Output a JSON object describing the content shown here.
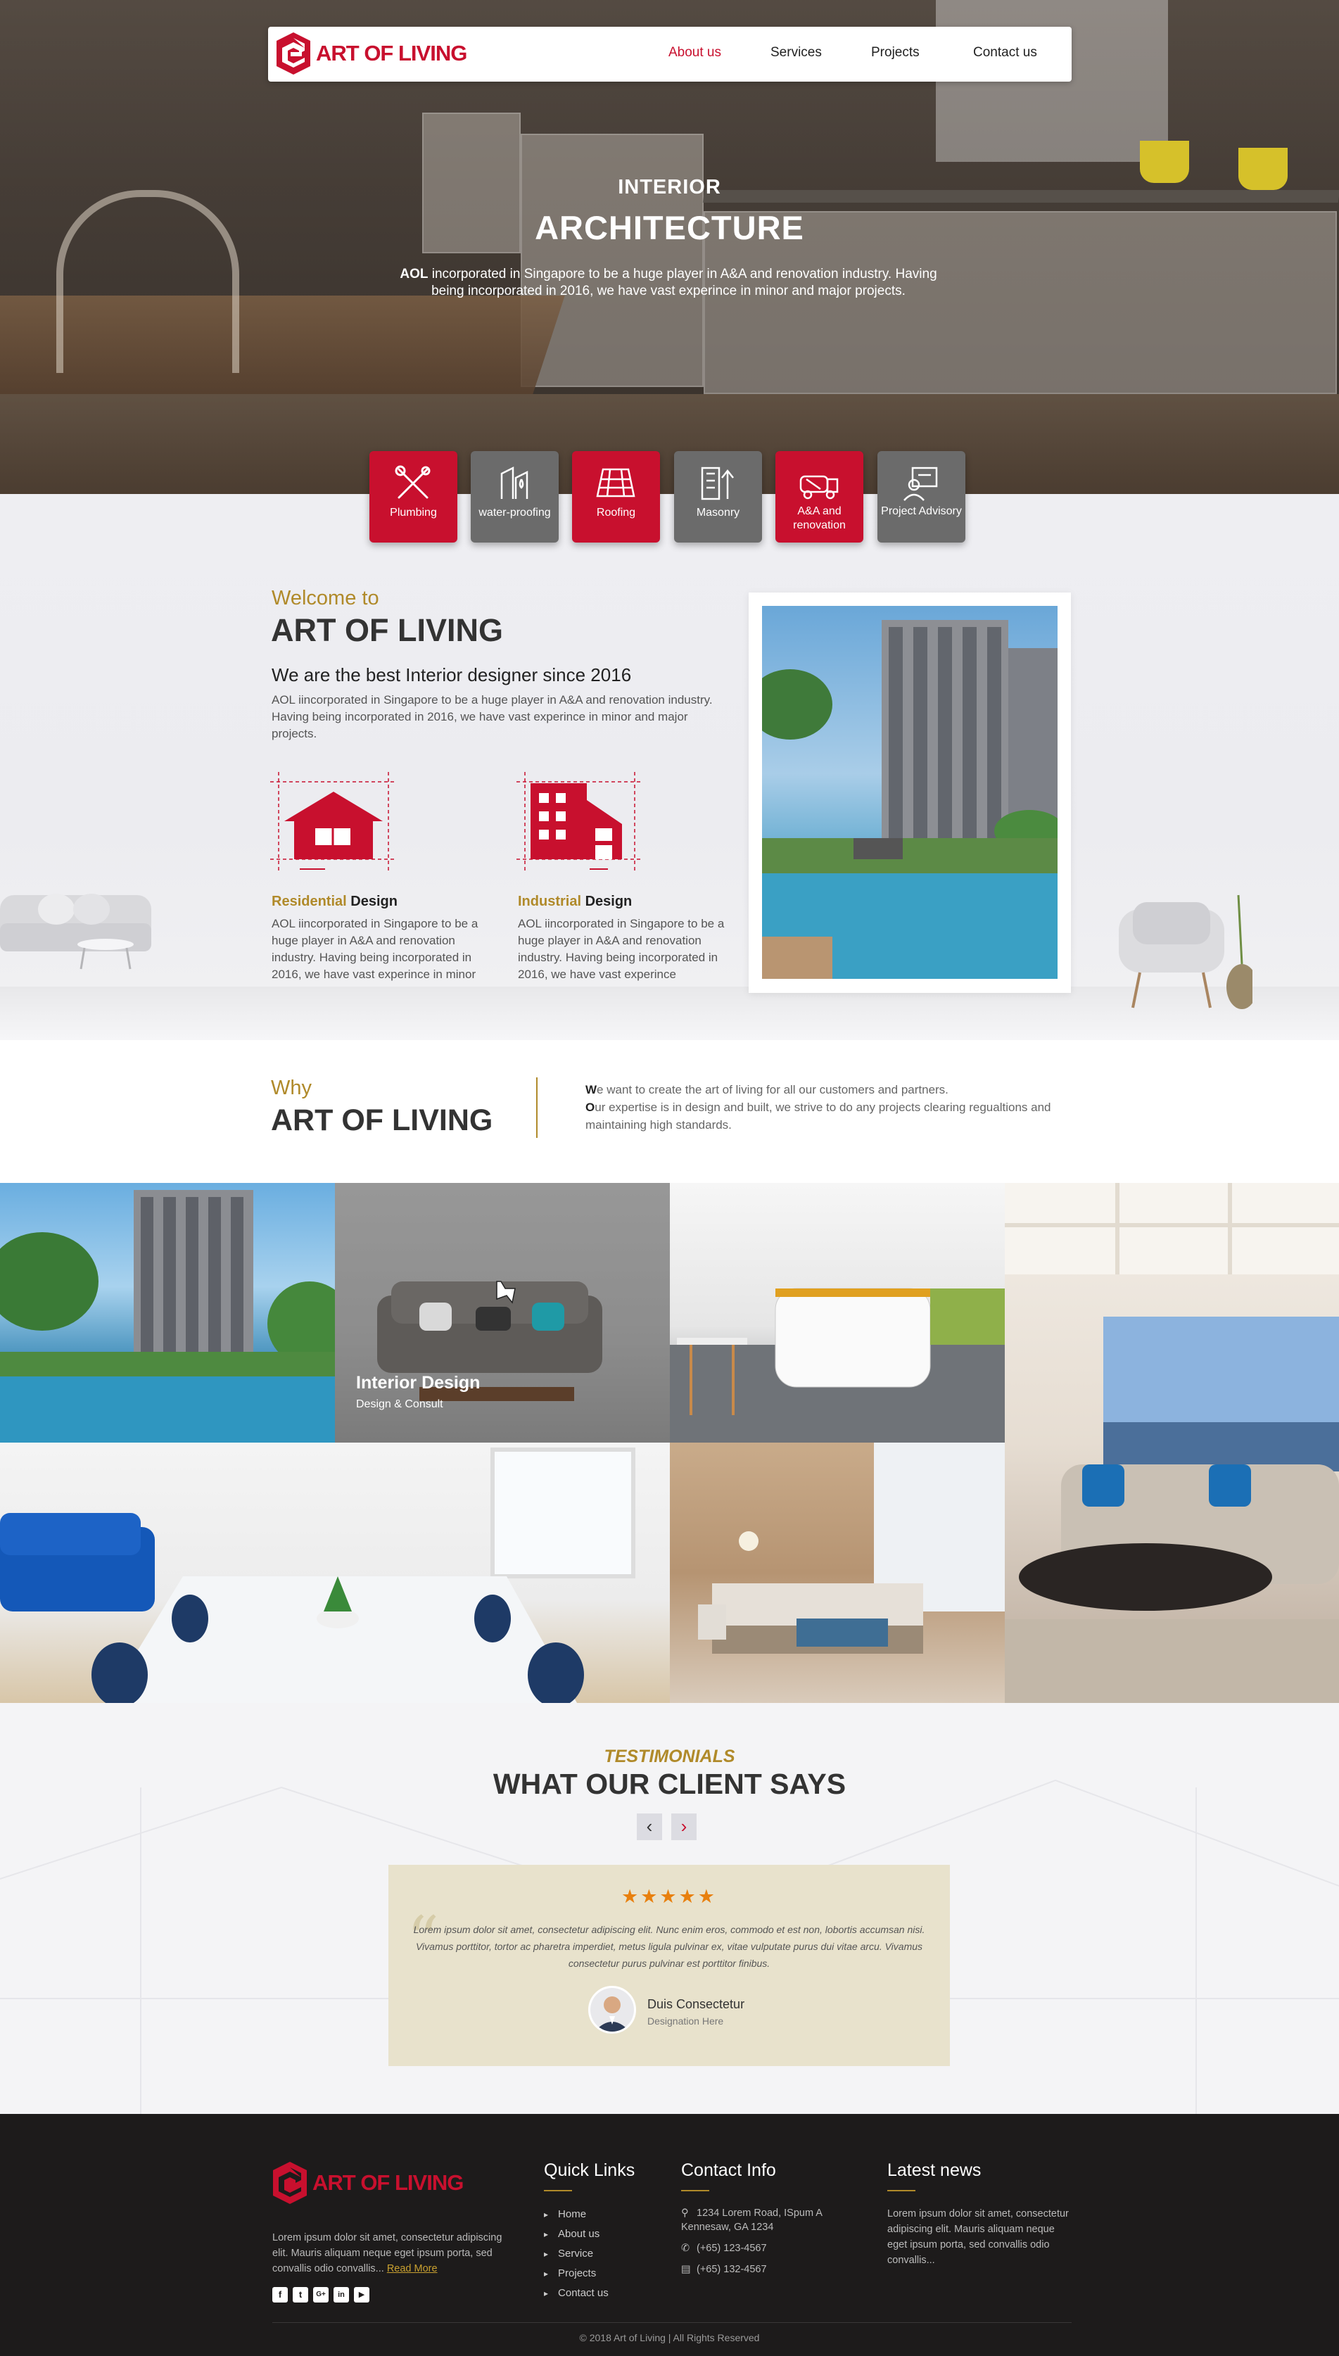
{
  "brand": {
    "name": "ART OF LIVING",
    "color": "#c8102e",
    "accent": "#b08a2a"
  },
  "nav": {
    "items": [
      {
        "label": "About us",
        "active": true
      },
      {
        "label": "Services",
        "active": false
      },
      {
        "label": "Projects",
        "active": false
      },
      {
        "label": "Contact us",
        "active": false
      }
    ]
  },
  "hero": {
    "subtitle": "INTERIOR",
    "title": "ARCHITECTURE",
    "desc_bold": "AOL",
    "desc": " incorporated in Singapore to be a huge player in A&A and renovation industry. Having being incorporated in 2016, we have vast experince in minor and major projects."
  },
  "services": [
    {
      "label": "Plumbing",
      "icon": "wrench-screwdriver-icon",
      "color": "red"
    },
    {
      "label": "water-proofing",
      "icon": "water-drops-icon",
      "color": "grey"
    },
    {
      "label": "Roofing",
      "icon": "roof-tiles-icon",
      "color": "red"
    },
    {
      "label": "Masonry",
      "icon": "brick-building-icon",
      "color": "grey"
    },
    {
      "label": "A&A and renovation",
      "icon": "cement-truck-icon",
      "color": "red"
    },
    {
      "label": "Project Advisory",
      "icon": "advisor-icon",
      "color": "grey"
    }
  ],
  "welcome": {
    "kicker": "Welcome to",
    "title": "ART OF LIVING",
    "subtitle": "We are the best Interior designer since 2016",
    "desc": "AOL iincorporated in Singapore to be a huge player in A&A and renovation industry. Having being incorporated in 2016, we have vast experince in minor and major projects.",
    "designs": [
      {
        "highlight": "Residential",
        "rest": " Design",
        "icon": "house-blueprint-icon",
        "desc": "AOL iincorporated in Singapore to be a huge player in A&A and renovation industry. Having being incorporated in 2016, we have vast experince in minor"
      },
      {
        "highlight": "Industrial",
        "rest": " Design",
        "icon": "building-blueprint-icon",
        "desc": "AOL iincorporated in Singapore to be a huge player in A&A and renovation industry. Having being incorporated in 2016, we have vast experince"
      }
    ]
  },
  "why": {
    "kicker": "Why",
    "title": "ART OF LIVING",
    "line1_first": "W",
    "line1_rest": "e want to create the art of living for all our customers and partners.",
    "line2_first": "O",
    "line2_rest": "ur expertise is in design and built, we strive to do any projects clearing regualtions and maintaining high standards."
  },
  "gallery": {
    "caption_title": "Interior Design",
    "caption_sub": "Design & Consult"
  },
  "testimonials": {
    "kicker": "TESTIMONIALS",
    "title": "WHAT OUR CLIENT SAYS",
    "prev": "‹",
    "next": "›",
    "stars": "★★★★★",
    "rating": 5,
    "quote": "Lorem ipsum dolor sit amet, consectetur adipiscing elit. Nunc enim eros, commodo et est non, lobortis accumsan nisi. Vivamus porttitor, tortor ac pharetra imperdiet, metus ligula pulvinar ex, vitae vulputate purus dui vitae arcu. Vivamus consectetur purus pulvinar est porttitor finibus.",
    "name": "Duis Consectetur",
    "role": "Designation Here"
  },
  "footer": {
    "about": "Lorem ipsum dolor sit amet, consectetur adipiscing elit. Mauris aliquam neque eget ipsum porta, sed convallis odio convallis...",
    "read_more": "Read More",
    "social": [
      "f",
      "t",
      "G+",
      "in",
      "▶"
    ],
    "quick_links_title": "Quick Links",
    "quick_links": [
      "Home",
      "About us",
      "Service",
      "Projects",
      "Contact us"
    ],
    "contact_title": "Contact Info",
    "address": "1234 Lorem Road, ISpum A Kennesaw, GA 1234",
    "phone": "(+65) 123-4567",
    "fax": "(+65) 132-4567",
    "news_title": "Latest news",
    "news": "Lorem ipsum dolor sit amet, consectetur adipiscing elit. Mauris aliquam neque eget ipsum porta, sed convallis odio convallis...",
    "copyright": "© 2018 Art of Living | All Rights Reserved"
  }
}
